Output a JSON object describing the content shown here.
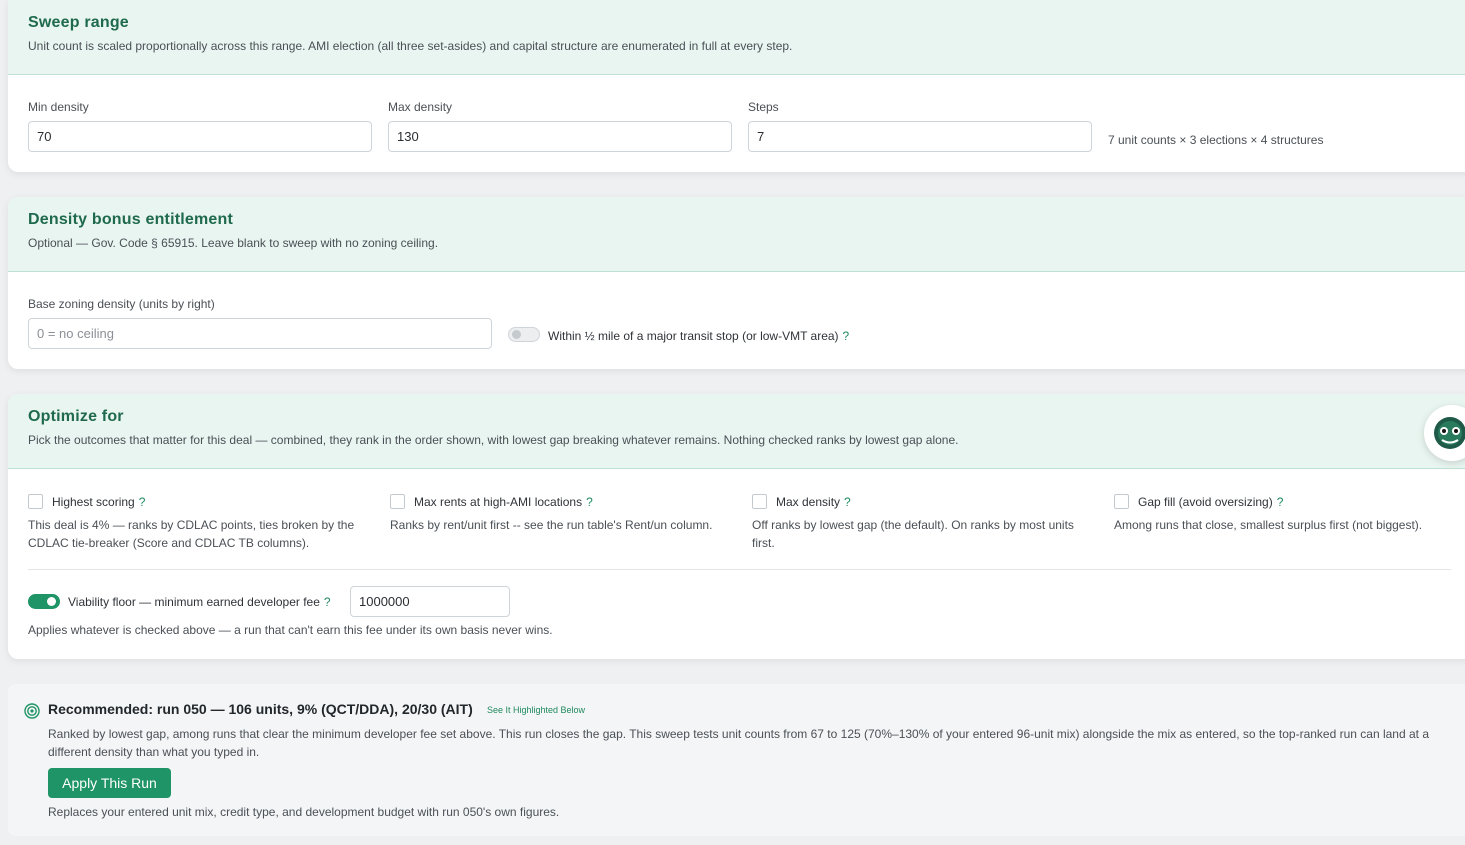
{
  "sweep_range": {
    "title": "Sweep range",
    "subtitle": "Unit count is scaled proportionally across this range. AMI election (all three set-asides) and capital structure are enumerated in full at every step.",
    "min_label": "Min density",
    "min_value": "70",
    "max_label": "Max density",
    "max_value": "130",
    "steps_label": "Steps",
    "steps_value": "7",
    "summary": "7 unit counts × 3 elections × 4 structures"
  },
  "density_bonus": {
    "title": "Density bonus entitlement",
    "subtitle": "Optional — Gov. Code § 65915. Leave blank to sweep with no zoning ceiling.",
    "base_label": "Base zoning density (units by right)",
    "base_placeholder": "0 = no ceiling",
    "transit_label": "Within ½ mile of a major transit stop (or low-VMT area)",
    "help": "?"
  },
  "optimize": {
    "title": "Optimize for",
    "subtitle": "Pick the outcomes that matter for this deal — combined, they rank in the order shown, with lowest gap breaking whatever remains. Nothing checked ranks by lowest gap alone.",
    "options": [
      {
        "label": "Highest scoring",
        "desc": "This deal is 4% — ranks by CDLAC points, ties broken by the CDLAC tie-breaker (Score and CDLAC TB columns)."
      },
      {
        "label": "Max rents at high-AMI locations",
        "desc": "Ranks by rent/unit first -- see the run table's Rent/un column."
      },
      {
        "label": "Max density",
        "desc": "Off ranks by lowest gap (the default). On ranks by most units first."
      },
      {
        "label": "Gap fill (avoid oversizing)",
        "desc": "Among runs that close, smallest surplus first (not biggest)."
      }
    ],
    "floor_label": "Viability floor — minimum earned developer fee",
    "floor_value": "1000000",
    "floor_note": "Applies whatever is checked above — a run that can't earn this fee under its own basis never wins.",
    "help": "?"
  },
  "recommendation": {
    "title": "Recommended: run 050 — 106 units, 9% (QCT/DDA), 20/30 (AIT)",
    "badge": "See It Highlighted Below",
    "body": "Ranked by lowest gap, among runs that clear the minimum developer fee set above. This run closes the gap. This sweep tests unit counts from 67 to 125 (70%–130% of your entered 96-unit mix) alongside the mix as entered, so the top-ranked run can land at a different density than what you typed in.",
    "apply_label": "Apply This Run",
    "footnote": "Replaces your entered unit mix, credit type, and development budget with run 050's own figures."
  },
  "colors": {
    "accent": "#1f9466",
    "title_green": "#1f6a4e",
    "header_bg": "#e9f5f0"
  }
}
